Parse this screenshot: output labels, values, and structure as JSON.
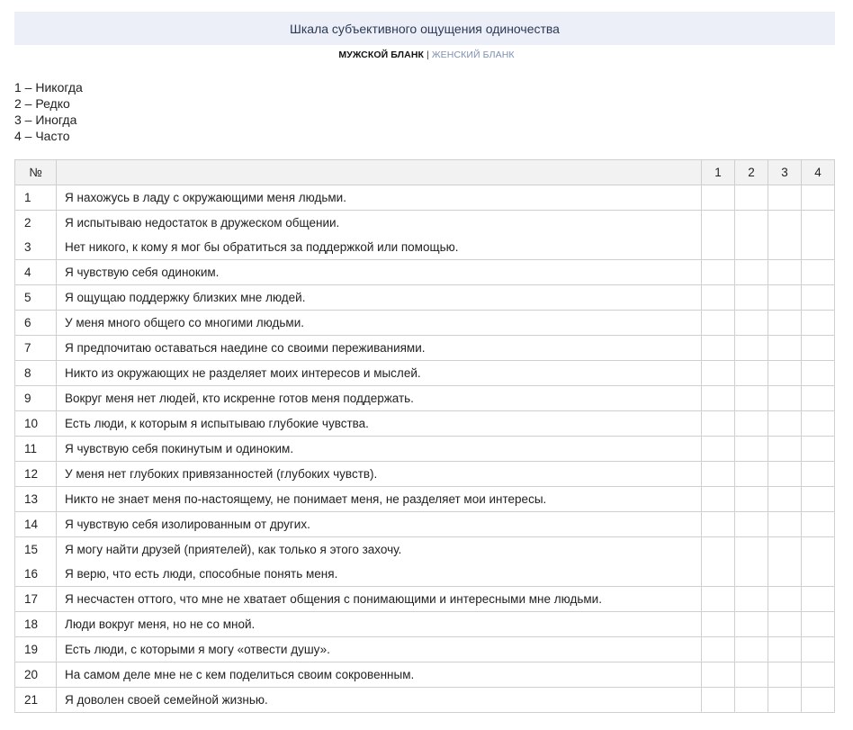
{
  "title": "Шкала субъективного ощущения одиночества",
  "form_switch": {
    "male": "МУЖСКОЙ БЛАНК",
    "separator": "|",
    "female": "ЖЕНСКИЙ БЛАНК"
  },
  "legend": [
    "1 – Никогда",
    "2 – Редко",
    "3 – Иногда",
    "4 – Часто"
  ],
  "table": {
    "headers": [
      "№",
      "",
      "1",
      "2",
      "3",
      "4"
    ],
    "rows": [
      {
        "n": "1",
        "text": "Я нахожусь в ладу с окружающими меня людьми."
      },
      {
        "n": "2",
        "text": "Я испытываю недостаток в дружеском общении."
      },
      {
        "n": "3",
        "text": "Нет никого, к кому я мог бы обратиться за поддержкой или помощью."
      },
      {
        "n": "4",
        "text": "Я чувствую себя одиноким."
      },
      {
        "n": "5",
        "text": "Я ощущаю поддержку близких мне людей."
      },
      {
        "n": "6",
        "text": "У меня много общего со многими людьми."
      },
      {
        "n": "7",
        "text": "Я предпочитаю оставаться наедине со своими переживаниями."
      },
      {
        "n": "8",
        "text": "Никто из окружающих не разделяет моих интересов и мыслей."
      },
      {
        "n": "9",
        "text": "Вокруг меня нет людей, кто искренне готов меня поддержать."
      },
      {
        "n": "10",
        "text": "Есть люди, к которым я испытываю глубокие чувства."
      },
      {
        "n": "11",
        "text": "Я чувствую себя покинутым и одиноким."
      },
      {
        "n": "12",
        "text": "У меня нет глубоких привязанностей (глубоких чувств)."
      },
      {
        "n": "13",
        "text": "Никто не знает меня по-настоящему, не понимает меня, не разделяет мои интересы."
      },
      {
        "n": "14",
        "text": "Я чувствую себя изолированным от других."
      },
      {
        "n": "15",
        "text": "Я могу найти друзей (приятелей), как только я этого захочу."
      },
      {
        "n": "16",
        "text": "Я верю, что есть люди, способные понять меня."
      },
      {
        "n": "17",
        "text": "Я несчастен оттого, что мне не хватает общения с понимающими и интересными мне людьми."
      },
      {
        "n": "18",
        "text": "Люди вокруг меня, но не со мной."
      },
      {
        "n": "19",
        "text": "Есть люди, с которыми я могу «отвести душу»."
      },
      {
        "n": "20",
        "text": "На самом деле мне не с кем поделиться своим сокровенным."
      },
      {
        "n": "21",
        "text": "Я доволен своей семейной жизнью."
      }
    ]
  }
}
